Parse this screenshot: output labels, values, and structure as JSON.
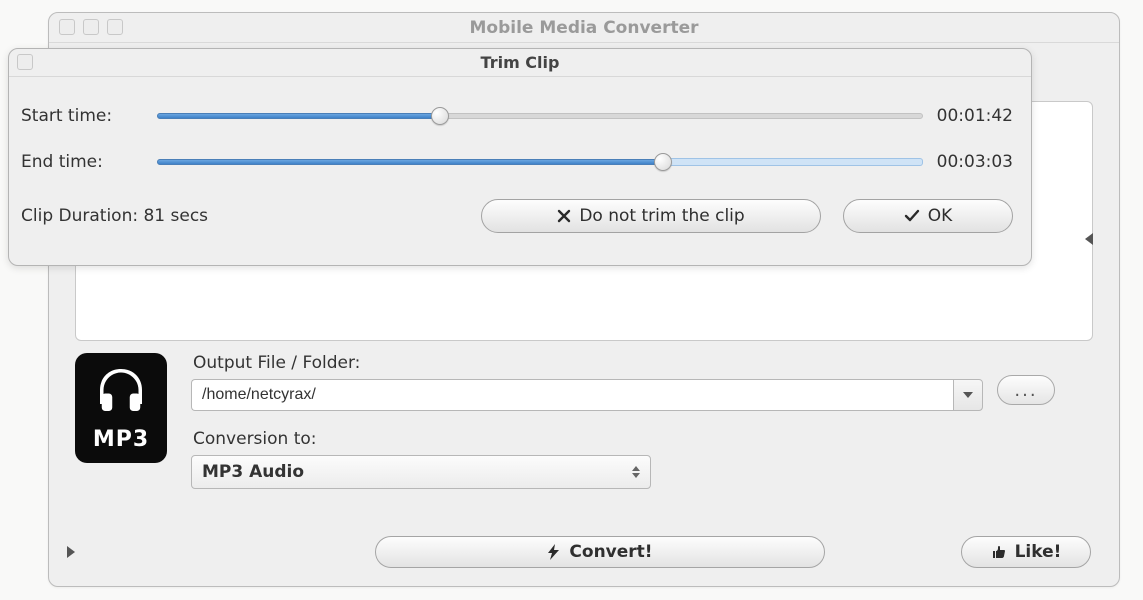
{
  "main_window": {
    "title": "Mobile Media Converter"
  },
  "trim_dialog": {
    "title": "Trim Clip",
    "start_label": "Start time:",
    "end_label": "End time:",
    "start_value": "00:01:42",
    "end_value": "00:03:03",
    "start_fill_percent": 37,
    "end_fill_percent": 66,
    "duration_label": "Clip Duration: 81 secs",
    "dont_trim_label": "Do not trim the clip",
    "ok_label": "OK"
  },
  "lower": {
    "badge_text": "MP3",
    "output_label": "Output File / Folder:",
    "output_path": "/home/netcyrax/",
    "browse_label": "...",
    "conversion_label": "Conversion to:",
    "conversion_value": "MP3 Audio"
  },
  "bottom": {
    "convert_label": "Convert!",
    "like_label": "Like!"
  }
}
